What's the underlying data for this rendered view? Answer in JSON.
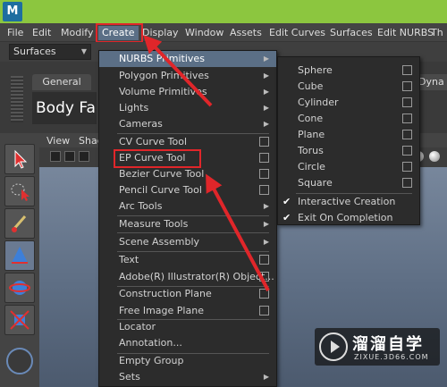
{
  "menubar": {
    "items": [
      "File",
      "Edit",
      "Modify",
      "Create",
      "Display",
      "Window",
      "Assets",
      "Edit Curves",
      "Surfaces",
      "Edit NURBS",
      "Th"
    ]
  },
  "toolbar": {
    "mode": "Surfaces"
  },
  "shelf": {
    "tab_general": "General",
    "body_face": "Body Face",
    "tab_dyna": "Dyna"
  },
  "viewport": {
    "menu": [
      "View",
      "Shad"
    ]
  },
  "create_menu": {
    "items": [
      {
        "label": "NURBS Primitives",
        "kind": "submenu",
        "highlighted": true
      },
      {
        "label": "Polygon Primitives",
        "kind": "submenu"
      },
      {
        "label": "Volume Primitives",
        "kind": "submenu"
      },
      {
        "label": "Lights",
        "kind": "submenu"
      },
      {
        "label": "Cameras",
        "kind": "submenu"
      },
      {
        "label": "CV Curve Tool",
        "kind": "option"
      },
      {
        "label": "EP Curve Tool",
        "kind": "option",
        "boxed": true
      },
      {
        "label": "Bezier Curve Tool",
        "kind": "option"
      },
      {
        "label": "Pencil Curve Tool",
        "kind": "option"
      },
      {
        "label": "Arc Tools",
        "kind": "submenu"
      },
      {
        "label": "Measure Tools",
        "kind": "submenu"
      },
      {
        "label": "Scene Assembly",
        "kind": "submenu"
      },
      {
        "label": "Text",
        "kind": "option"
      },
      {
        "label": "Adobe(R) Illustrator(R) Object...",
        "kind": "option"
      },
      {
        "label": "Construction Plane",
        "kind": "option"
      },
      {
        "label": "Free Image Plane",
        "kind": "option"
      },
      {
        "label": "Locator",
        "kind": "plain"
      },
      {
        "label": "Annotation...",
        "kind": "plain"
      },
      {
        "label": "Empty Group",
        "kind": "plain"
      },
      {
        "label": "Sets",
        "kind": "submenu"
      }
    ]
  },
  "nurbs_submenu": {
    "items": [
      {
        "label": "Sphere"
      },
      {
        "label": "Cube"
      },
      {
        "label": "Cylinder"
      },
      {
        "label": "Cone"
      },
      {
        "label": "Plane"
      },
      {
        "label": "Torus"
      },
      {
        "label": "Circle"
      },
      {
        "label": "Square"
      }
    ],
    "toggles": [
      {
        "label": "Interactive Creation",
        "checked": true
      },
      {
        "label": "Exit On Completion",
        "checked": true
      }
    ]
  },
  "watermark": {
    "title": "溜溜自学",
    "url": "ZIXUE.3D66.COM"
  },
  "colors": {
    "menu_highlight": "#5b6f86",
    "annotation_red": "#e0262a",
    "title_green": "#8cc63f"
  }
}
